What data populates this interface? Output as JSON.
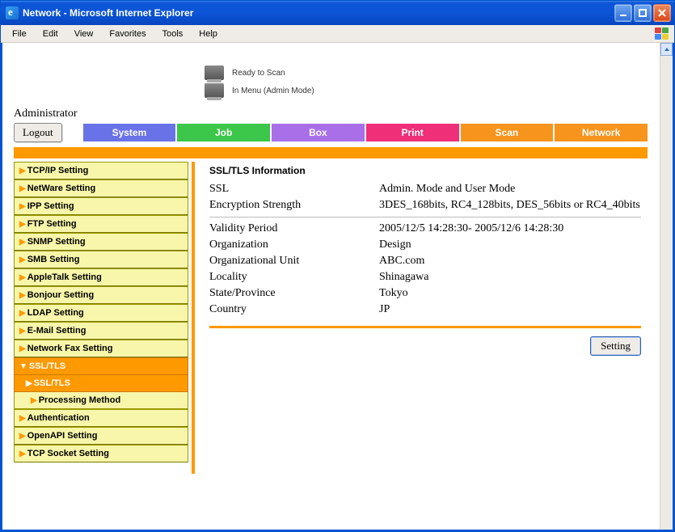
{
  "window": {
    "title": "Network - Microsoft Internet Explorer"
  },
  "menubar": [
    "File",
    "Edit",
    "View",
    "Favorites",
    "Tools",
    "Help"
  ],
  "status": {
    "line1": "Ready to Scan",
    "line2": "In Menu (Admin Mode)"
  },
  "admin_label": "Administrator",
  "logout_label": "Logout",
  "tabs": [
    {
      "label": "System",
      "color": "#6a72e8"
    },
    {
      "label": "Job",
      "color": "#3cc64a"
    },
    {
      "label": "Box",
      "color": "#a96fe8"
    },
    {
      "label": "Print",
      "color": "#ef2f78"
    },
    {
      "label": "Scan",
      "color": "#f7941d"
    },
    {
      "label": "Network",
      "color": "#f7941d"
    }
  ],
  "sidebar": {
    "items": [
      "TCP/IP Setting",
      "NetWare Setting",
      "IPP Setting",
      "FTP Setting",
      "SNMP Setting",
      "SMB Setting",
      "AppleTalk Setting",
      "Bonjour Setting",
      "LDAP Setting",
      "E-Mail Setting",
      "Network Fax Setting"
    ],
    "selected": "SSL/TLS",
    "sub_selected": "SSL/TLS",
    "sub2": "Processing Method",
    "after": [
      "Authentication",
      "OpenAPI Setting",
      "TCP Socket Setting"
    ]
  },
  "detail": {
    "heading": "SSL/TLS Information",
    "rows_top": [
      {
        "k": "SSL",
        "v": "Admin. Mode and User Mode"
      },
      {
        "k": "Encryption Strength",
        "v": "3DES_168bits, RC4_128bits, DES_56bits or RC4_40bits"
      }
    ],
    "rows_bottom": [
      {
        "k": "Validity Period",
        "v": "2005/12/5 14:28:30- 2005/12/6 14:28:30"
      },
      {
        "k": "Organization",
        "v": "Design"
      },
      {
        "k": "Organizational Unit",
        "v": "ABC.com"
      },
      {
        "k": "Locality",
        "v": "Shinagawa"
      },
      {
        "k": "State/Province",
        "v": "Tokyo"
      },
      {
        "k": "Country",
        "v": "JP"
      }
    ],
    "setting_label": "Setting"
  }
}
